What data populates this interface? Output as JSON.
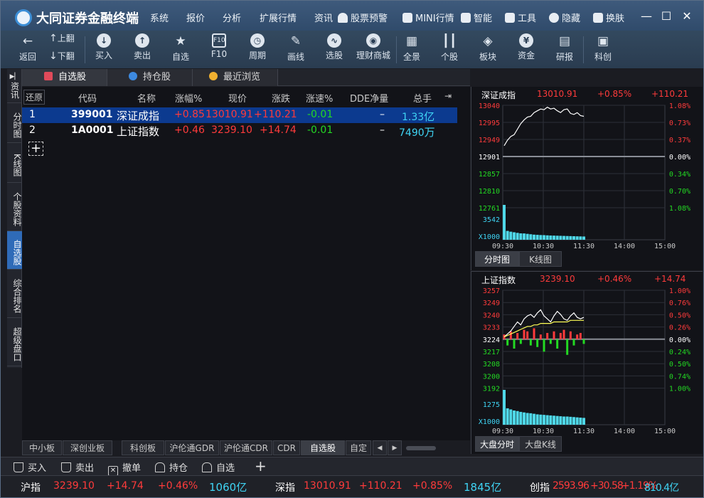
{
  "app": {
    "title": "大同证券金融终端"
  },
  "menu": [
    {
      "label": "系统",
      "icon": ""
    },
    {
      "label": "报价",
      "icon": ""
    },
    {
      "label": "分析",
      "icon": ""
    },
    {
      "label": "扩展行情",
      "icon": ""
    },
    {
      "label": "资讯",
      "icon": ""
    },
    {
      "label": "股票预警",
      "icon": "bell-icon"
    },
    {
      "label": "MINI行情",
      "icon": "mini-window-icon"
    },
    {
      "label": "智能",
      "icon": "robot-icon"
    },
    {
      "label": "工具",
      "icon": "tools-icon"
    },
    {
      "label": "隐藏",
      "icon": "hide-icon"
    },
    {
      "label": "换肤",
      "icon": "shirt-icon"
    }
  ],
  "window_buttons": {
    "minimize": "—",
    "maximize": "☐",
    "close": "✕"
  },
  "toolbar": {
    "back": "返回",
    "page_up": "上翻",
    "page_down": "下翻",
    "buy": "买入",
    "sell": "卖出",
    "watchlist": "自选",
    "f10": "F10",
    "period": "周期",
    "draw": "画线",
    "pick": "选股",
    "mall": "理财商城",
    "overview": "全景",
    "stock": "个股",
    "sector": "板块",
    "funds": "资金",
    "research": "研报",
    "star": "科创"
  },
  "vtabs": [
    "资讯",
    "分时图",
    "K线图",
    "个股资料",
    "自选股",
    "综合排名",
    "超级盘口"
  ],
  "toptabs": [
    {
      "label": "自选股",
      "color": "#e04a5a"
    },
    {
      "label": "持仓股",
      "color": "#3d8ae0"
    },
    {
      "label": "最近浏览",
      "color": "#f0b030"
    }
  ],
  "table": {
    "restore": "还原",
    "headers": [
      "代码",
      "名称",
      "涨幅%",
      "现价",
      "涨跌",
      "涨速%",
      "DDE净量",
      "总手"
    ],
    "rows": [
      {
        "no": "1",
        "code": "399001",
        "name": "深证成指",
        "pct": "+0.85",
        "price": "13010.91",
        "chg": "+110.21",
        "speed": "-0.01",
        "dde": "–",
        "vol": "1.33",
        "vol_unit": "亿"
      },
      {
        "no": "2",
        "code": "1A0001",
        "name": "上证指数",
        "pct": "+0.46",
        "price": "3239.10",
        "chg": "+14.74",
        "speed": "-0.01",
        "dde": "–",
        "vol": "7490",
        "vol_unit": "万"
      }
    ]
  },
  "sheet_tabs": [
    "中小板",
    "深创业板",
    "科创板",
    "沪伦通GDR",
    "沪伦通CDR",
    "CDR",
    "自选股",
    "自定"
  ],
  "chart_data": [
    {
      "type": "line",
      "title": "深证成指",
      "price": "13010.91",
      "pct": "+0.85%",
      "chg": "+110.21",
      "y_left": [
        "13040",
        "12995",
        "12949",
        "12901",
        "12857",
        "12810",
        "12761"
      ],
      "y_right": [
        "1.08%",
        "0.73%",
        "0.37%",
        "0.00%",
        "0.34%",
        "0.70%",
        "1.08%"
      ],
      "vol_labels": [
        "3542",
        "X1000"
      ],
      "x": [
        "09:30",
        "10:30",
        "11:30",
        "14:00",
        "15:00"
      ],
      "series": [
        {
          "values": [
            12930,
            12945,
            12955,
            12960,
            12975,
            12990,
            13000,
            13008,
            13010,
            13020,
            13025,
            13030,
            13028,
            13035,
            13030,
            13032,
            13025,
            13020,
            13028,
            13030,
            13018,
            13015,
            13020,
            13012,
            13010
          ]
        }
      ],
      "volume": [
        3542,
        900,
        820,
        760,
        700,
        650,
        640,
        600,
        560,
        520,
        500,
        480,
        470,
        450,
        430,
        420,
        410,
        400,
        390,
        380,
        370,
        360,
        350,
        340,
        330
      ],
      "ylim": [
        12761,
        13040
      ],
      "buttons": [
        "分时图",
        "K线图"
      ]
    },
    {
      "type": "line",
      "title": "上证指数",
      "price": "3239.10",
      "pct": "+0.46%",
      "chg": "+14.74",
      "y_left": [
        "3257",
        "3249",
        "3240",
        "3233",
        "3224",
        "3217",
        "3208",
        "3200",
        "3192"
      ],
      "y_right": [
        "1.00%",
        "0.76%",
        "0.50%",
        "0.26%",
        "0.00%",
        "0.24%",
        "0.50%",
        "0.74%",
        "1.00%"
      ],
      "vol_labels": [
        "1275",
        "X1000"
      ],
      "x": [
        "09:30",
        "10:30",
        "11:30",
        "14:00",
        "15:00"
      ],
      "series": [
        {
          "name": "price",
          "values": [
            3226,
            3228,
            3230,
            3233,
            3236,
            3234,
            3238,
            3240,
            3241,
            3239,
            3242,
            3244,
            3240,
            3238,
            3236,
            3240,
            3243,
            3241,
            3238,
            3237,
            3240,
            3242,
            3239,
            3238,
            3239
          ]
        },
        {
          "name": "avg",
          "values": [
            3226,
            3227,
            3228,
            3229,
            3230,
            3231,
            3232,
            3233,
            3233,
            3234,
            3234,
            3235,
            3235,
            3235,
            3235,
            3236,
            3236,
            3236,
            3236,
            3236,
            3237,
            3237,
            3237,
            3237,
            3237
          ]
        }
      ],
      "bars": [
        3,
        -4,
        5,
        -6,
        4,
        -3,
        6,
        5,
        -4,
        7,
        -5,
        3,
        -8,
        4,
        -3,
        5,
        -6,
        4,
        6,
        -10,
        5,
        -4,
        3,
        4,
        -3
      ],
      "volume": [
        1275,
        600,
        560,
        520,
        500,
        470,
        450,
        430,
        420,
        400,
        380,
        370,
        360,
        350,
        340,
        330,
        320,
        310,
        300,
        300,
        290,
        280,
        270,
        260,
        250
      ],
      "ylim": [
        3192,
        3257
      ],
      "buttons": [
        "大盘分时",
        "大盘K线"
      ]
    }
  ],
  "actions": [
    "买入",
    "卖出",
    "撤单",
    "持仓",
    "自选"
  ],
  "status": [
    {
      "name": "沪指",
      "price": "3239.10",
      "chg": "+14.74",
      "pct": "+0.46%",
      "amt": "1060",
      "unit": "亿"
    },
    {
      "name": "深指",
      "price": "13010.91",
      "chg": "+110.21",
      "pct": "+0.85%",
      "amt": "1845",
      "unit": "亿"
    },
    {
      "name": "创指",
      "price": "2593.96",
      "chg": "+30.58",
      "pct": "+1.19%",
      "amt": "810.4",
      "unit": "亿"
    }
  ],
  "colors": {
    "up": "#ff3b3b",
    "down": "#23d923",
    "accent": "#0c3a8f",
    "titlebar": "#3e5a7c"
  }
}
